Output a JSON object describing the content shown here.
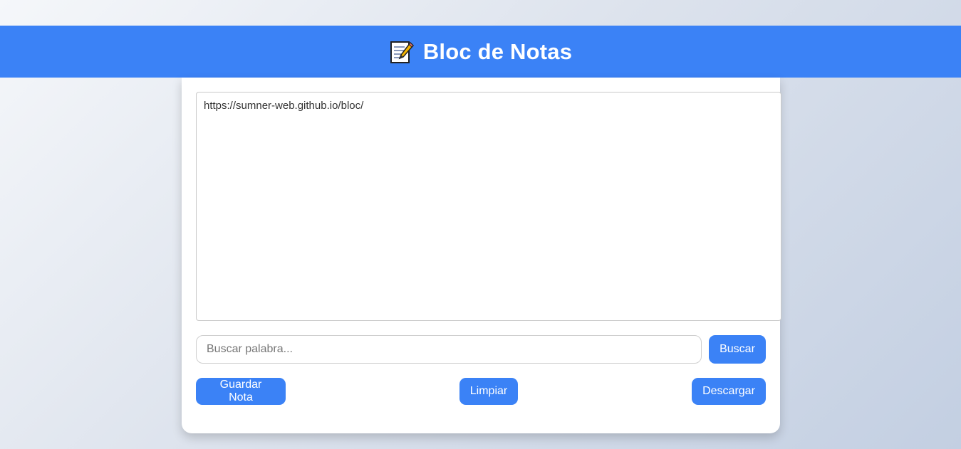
{
  "header": {
    "icon": "memo-icon",
    "title": "Bloc de Notas",
    "background_color": "#3b82f6"
  },
  "editor": {
    "content": "https://sumner-web.github.io/bloc/"
  },
  "search": {
    "placeholder": "Buscar palabra...",
    "value": "",
    "button_label": "Buscar"
  },
  "actions": {
    "save_label": "Guardar Nota",
    "clear_label": "Limpiar",
    "download_label": "Descargar"
  },
  "colors": {
    "accent": "#3b82f6",
    "card": "#ffffff"
  }
}
